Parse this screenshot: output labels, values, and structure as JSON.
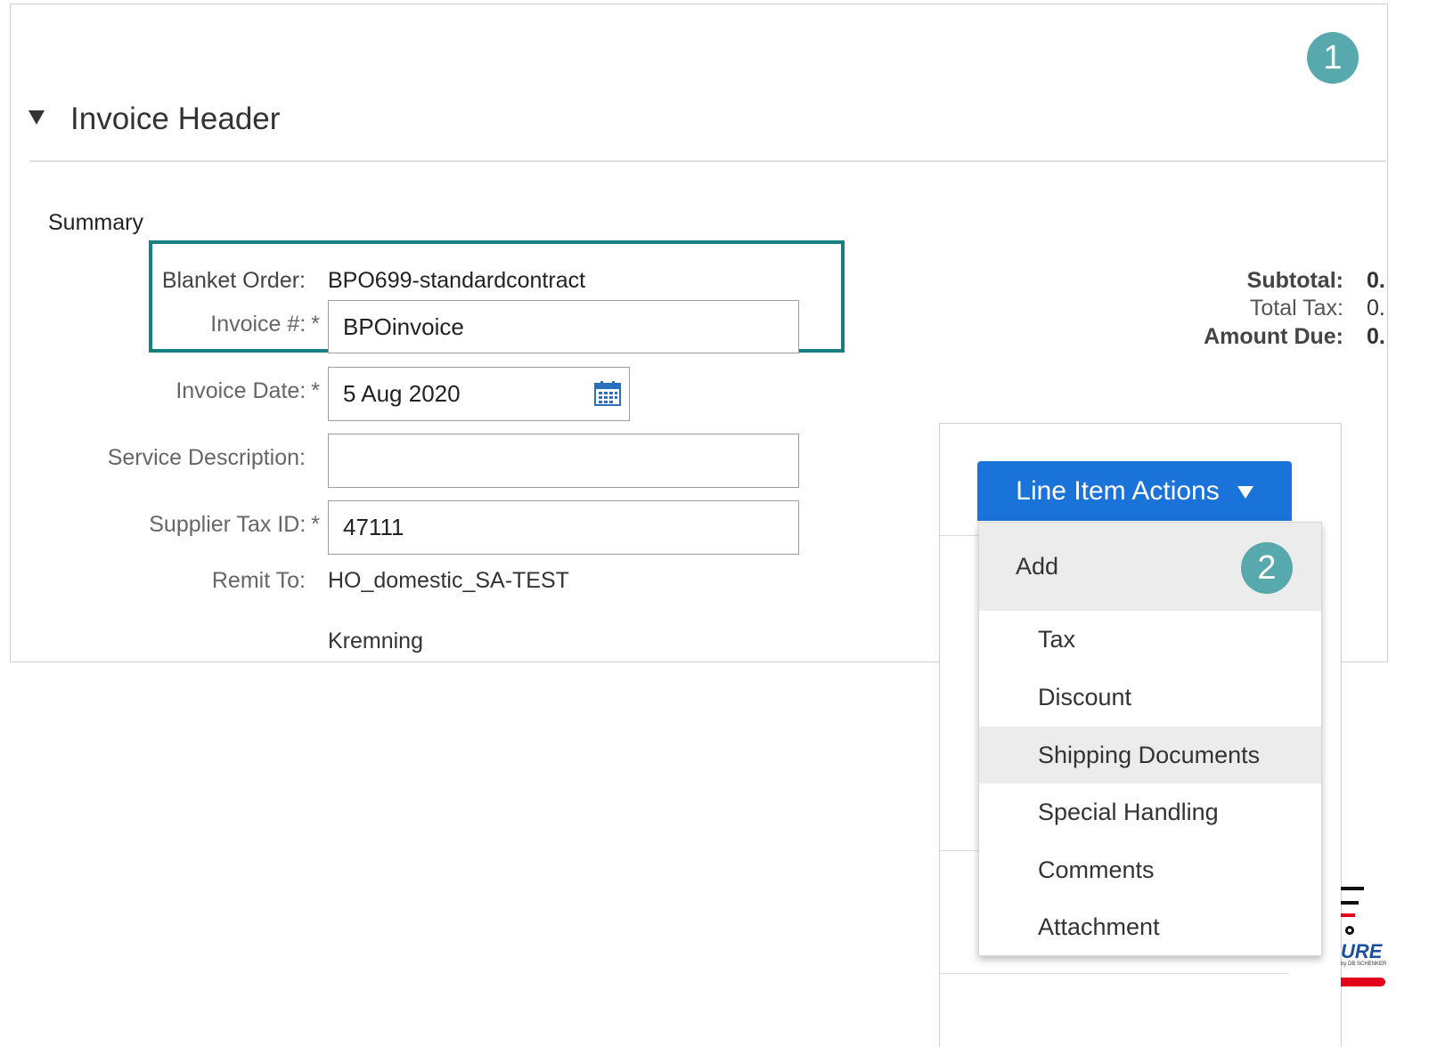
{
  "invoice_header": {
    "title": "Invoice Header",
    "summary_label": "Summary",
    "fields": {
      "blanket_order_label": "Blanket Order:",
      "blanket_order_value": "BPO699-standardcontract",
      "invoice_number_label": "Invoice #:",
      "invoice_number_value": "BPOinvoice",
      "invoice_date_label": "Invoice Date:",
      "invoice_date_value": "5 Aug 2020",
      "service_description_label": "Service Description:",
      "service_description_value": "",
      "supplier_tax_id_label": "Supplier Tax ID:",
      "supplier_tax_id_value": "47111",
      "remit_to_label": "Remit To:",
      "remit_to_line1": "HO_domestic_SA-TEST",
      "remit_to_line2": "Kremning",
      "required_marker": "*"
    },
    "totals": {
      "subtotal_label": "Subtotal:",
      "subtotal_value": "0.",
      "total_tax_label": "Total Tax:",
      "total_tax_value": "0.",
      "amount_due_label": "Amount Due:",
      "amount_due_value": "0."
    }
  },
  "line_item_actions": {
    "button_label": "Line Item Actions",
    "menu": {
      "header": "Add",
      "items": [
        "Tax",
        "Discount",
        "Shipping Documents",
        "Special Handling",
        "Comments",
        "Attachment"
      ],
      "highlighted_item": "Shipping Documents"
    }
  },
  "callouts": {
    "badge_1": "1",
    "badge_2": "2"
  },
  "logo": {
    "text": "URE",
    "subtext": "by DB SCHENKER"
  },
  "colors": {
    "primary_button": "#1a73d8",
    "highlight_border": "#167f82",
    "badge": "#58a9ad",
    "logo_red": "#e3001b"
  },
  "icons": {
    "collapse": "triangle-down-icon",
    "calendar": "calendar-icon",
    "dropdown": "caret-down-icon"
  }
}
